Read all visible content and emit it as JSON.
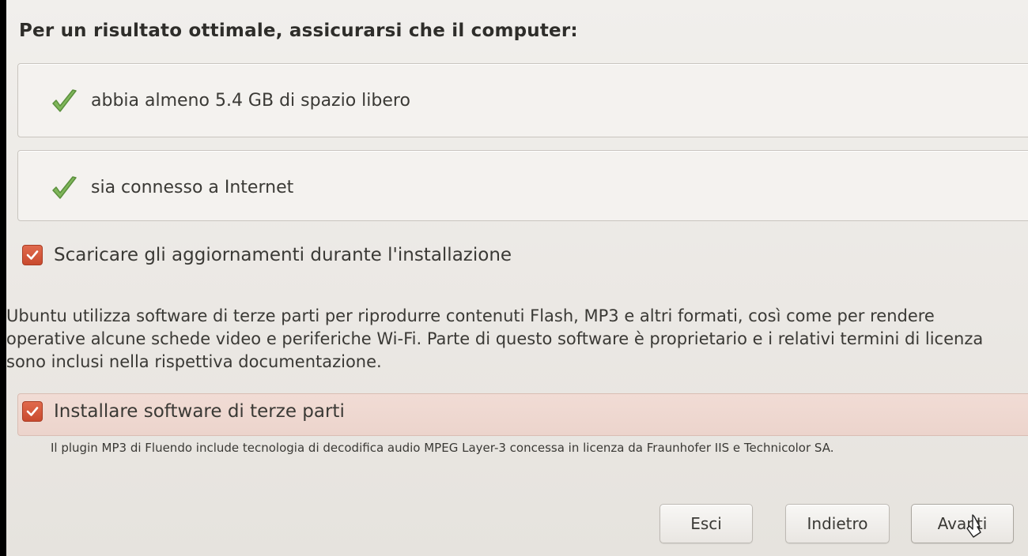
{
  "heading": "Per un risultato ottimale, assicurarsi che il computer:",
  "requirements": [
    {
      "icon": "green-check-icon",
      "text": "abbia almeno 5.4 GB di spazio libero"
    },
    {
      "icon": "green-check-icon",
      "text": "sia connesso a Internet"
    }
  ],
  "options": {
    "download_updates": {
      "label": "Scaricare gli aggiornamenti durante l'installazione",
      "checked": true
    },
    "third_party": {
      "label": "Installare software di terze parti",
      "checked": true
    }
  },
  "info_text": "Ubuntu utilizza software di terze parti per riprodurre contenuti Flash, MP3 e altri formati, così come per rendere operative alcune schede video e periferiche Wi-Fi. Parte di questo software è proprietario e i relativi termini di licenza sono inclusi nella rispettiva documentazione.",
  "plugin_note": "Il plugin MP3 di Fluendo include tecnologia di decodifica audio MPEG Layer-3 concessa in licenza da Fraunhofer IIS e Technicolor SA.",
  "buttons": {
    "quit": "Esci",
    "back": "Indietro",
    "next": "Avanti"
  },
  "colors": {
    "checkbox_accent": "#dd4814",
    "check_green": "#6aa84f",
    "highlight_row": "#ecd4cc"
  }
}
